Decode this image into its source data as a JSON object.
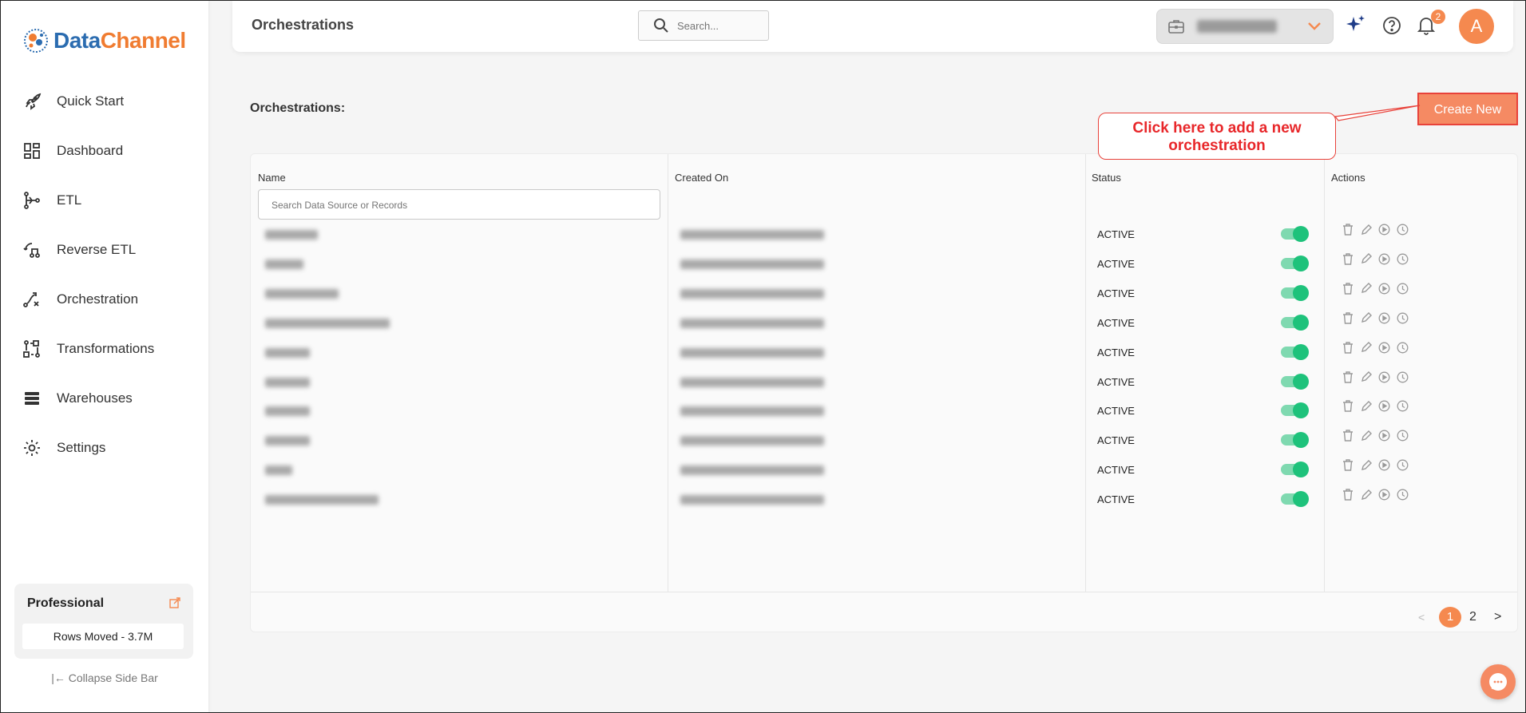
{
  "brand": {
    "logo_text_1": "Data",
    "logo_text_2": "Channel"
  },
  "sidebar": {
    "items": [
      {
        "label": "Quick Start",
        "icon": "rocket-icon"
      },
      {
        "label": "Dashboard",
        "icon": "dashboard-icon"
      },
      {
        "label": "ETL",
        "icon": "etl-icon"
      },
      {
        "label": "Reverse ETL",
        "icon": "reverse-etl-icon"
      },
      {
        "label": "Orchestration",
        "icon": "orchestration-icon"
      },
      {
        "label": "Transformations",
        "icon": "transformations-icon"
      },
      {
        "label": "Warehouses",
        "icon": "warehouses-icon"
      },
      {
        "label": "Settings",
        "icon": "gear-icon"
      }
    ],
    "plan": {
      "title": "Professional",
      "rows": "Rows Moved - 3.7M"
    },
    "collapse_label": "Collapse Side Bar"
  },
  "header": {
    "title": "Orchestrations",
    "search_placeholder": "Search...",
    "notification_count": "2",
    "avatar_letter": "A"
  },
  "main": {
    "heading": "Orchestrations:",
    "create_label": "Create New",
    "callout": "Click here to add a new orchestration"
  },
  "table": {
    "columns": [
      "Name",
      "Created On",
      "Status",
      "Actions"
    ],
    "search_placeholder": "Search Data Source or Records",
    "rows": [
      {
        "status": "ACTIVE",
        "enabled": true
      },
      {
        "status": "ACTIVE",
        "enabled": true
      },
      {
        "status": "ACTIVE",
        "enabled": true
      },
      {
        "status": "ACTIVE",
        "enabled": true
      },
      {
        "status": "ACTIVE",
        "enabled": true
      },
      {
        "status": "ACTIVE",
        "enabled": true
      },
      {
        "status": "ACTIVE",
        "enabled": true
      },
      {
        "status": "ACTIVE",
        "enabled": true
      },
      {
        "status": "ACTIVE",
        "enabled": true
      },
      {
        "status": "ACTIVE",
        "enabled": true
      }
    ],
    "pagination": {
      "current": "1",
      "next": "2"
    }
  },
  "colors": {
    "accent": "#f5894f",
    "toggle_on": "#1ec27b",
    "callout_red": "#e8272a"
  }
}
